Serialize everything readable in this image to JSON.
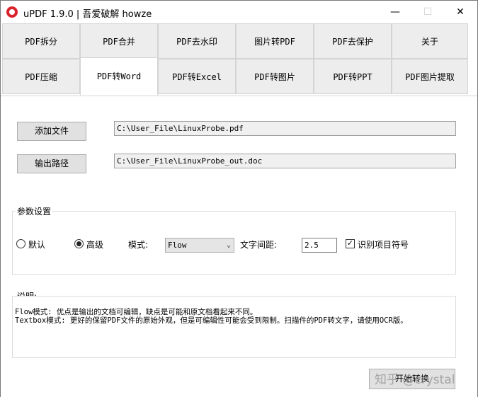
{
  "window": {
    "title": "uPDF 1.9.0 | 吾爱破解 howze",
    "minimize": "—",
    "maximize": "☐",
    "close": "✕"
  },
  "tabs": {
    "row1": [
      "PDF拆分",
      "PDF合并",
      "PDF去水印",
      "图片转PDF",
      "PDF去保护",
      "关于"
    ],
    "row2": [
      "PDF压缩",
      "PDF转Word",
      "PDF转Excel",
      "PDF转图片",
      "PDF转PPT",
      "PDF图片提取"
    ],
    "active": "PDF转Word"
  },
  "main": {
    "add_file_label": "添加文件",
    "input_path": "C:\\User_File\\LinuxProbe.pdf",
    "output_label": "输出路径",
    "output_path": "C:\\User_File\\LinuxProbe_out.doc"
  },
  "settings": {
    "group_label": "参数设置",
    "radio_default": "默认",
    "radio_advanced": "高级",
    "selected_radio": "高级",
    "mode_label": "模式:",
    "mode_value": "Flow",
    "spacing_label": "文字间距:",
    "spacing_value": "2.5",
    "bullet_label": "识别项目符号",
    "bullet_checked": true
  },
  "description": {
    "label": "说明:",
    "line1": "Flow模式: 优点是输出的文档可编辑，缺点是可能和原文档看起来不同。",
    "line2": "Textbox模式: 更好的保留PDF文件的原始外观，但是可编辑性可能会受到限制。扫描件的PDF转文字，请使用OCR版。"
  },
  "start_button": "开始转换",
  "watermark": "知乎 @crystal"
}
